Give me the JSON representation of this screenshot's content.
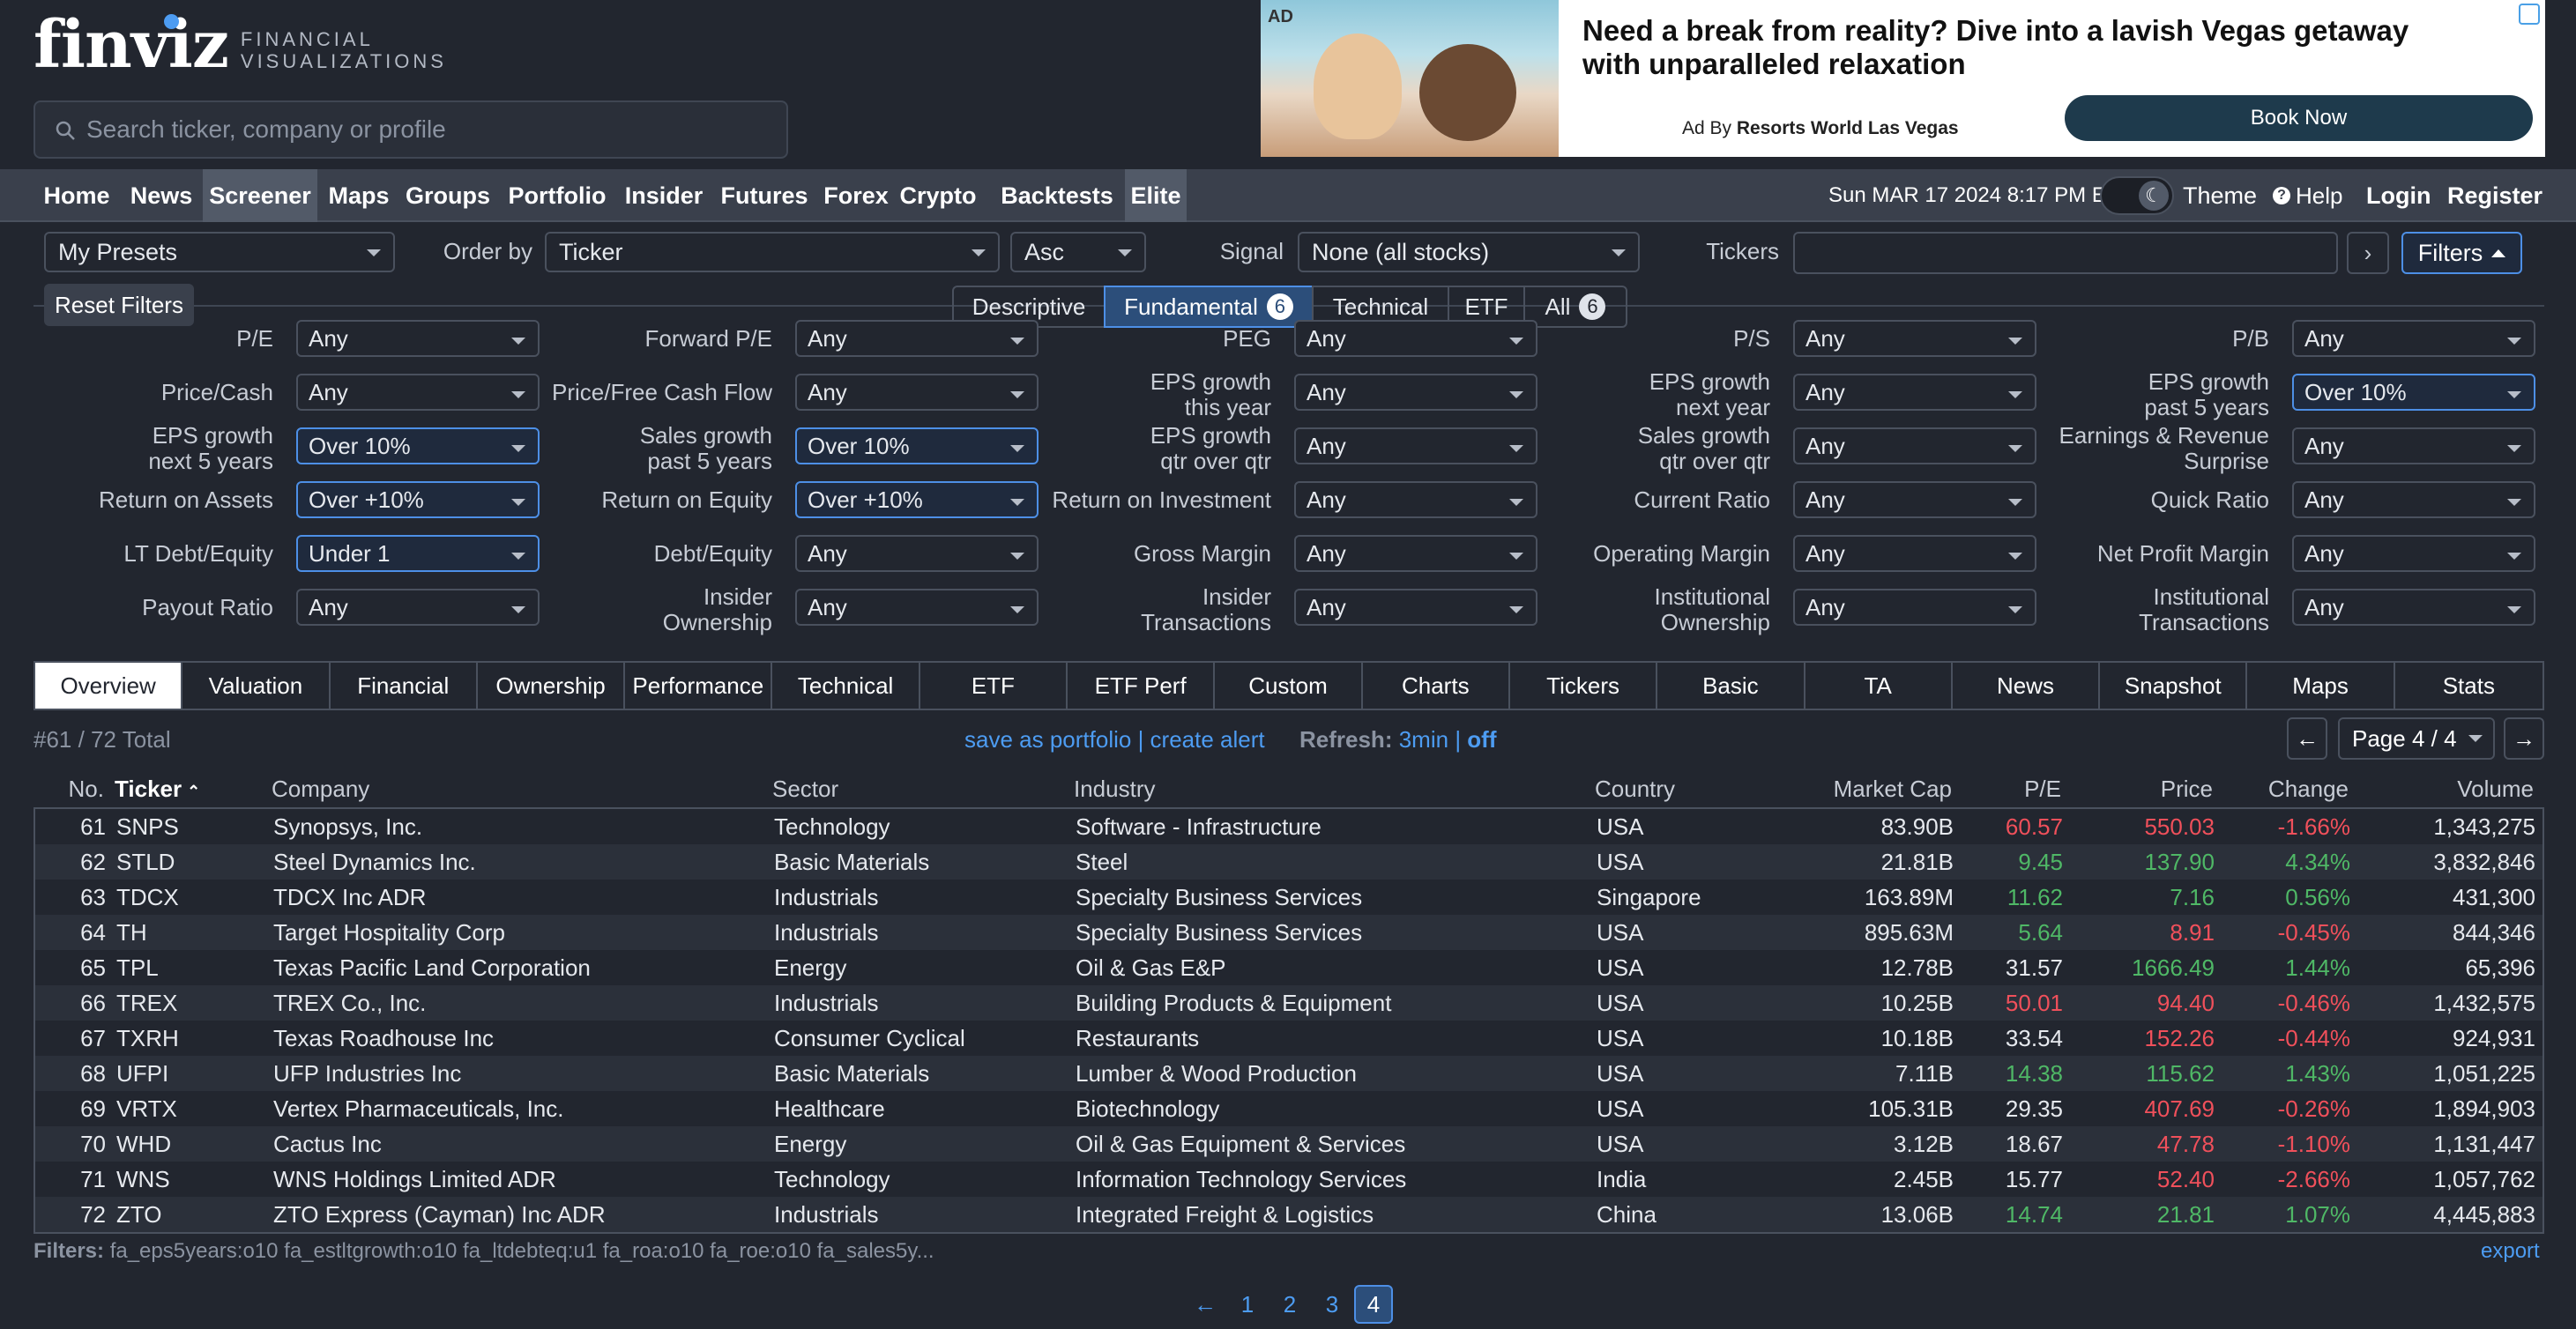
{
  "logo": {
    "word": "finviz",
    "sub1": "FINANCIAL",
    "sub2": "VISUALIZATIONS"
  },
  "search": {
    "placeholder": "Search ticker, company or profile"
  },
  "ad": {
    "tag": "AD",
    "headline": "Need a break from reality? Dive into a lavish Vegas getaway with unparalleled relaxation",
    "by_prefix": "Ad By ",
    "by_name": "Resorts World Las Vegas",
    "button": "Book Now"
  },
  "nav": {
    "items": [
      "Home",
      "News",
      "Screener",
      "Maps",
      "Groups",
      "Portfolio",
      "Insider",
      "Futures",
      "Forex",
      "Crypto",
      "Backtests",
      "Elite"
    ],
    "active": "Screener",
    "datetime": "Sun MAR 17 2024 8:17 PM ET",
    "theme": "Theme",
    "help": "Help",
    "login": "Login",
    "register": "Register"
  },
  "controls": {
    "presets": "My Presets",
    "order_by_label": "Order by",
    "order_by": "Ticker",
    "order_dir": "Asc",
    "signal_label": "Signal",
    "signal": "None (all stocks)",
    "tickers_label": "Tickers",
    "filters_button": "Filters"
  },
  "filter_tabs": {
    "reset": "Reset Filters",
    "tabs": [
      {
        "label": "Descriptive",
        "badge": ""
      },
      {
        "label": "Fundamental",
        "badge": "6"
      },
      {
        "label": "Technical",
        "badge": ""
      },
      {
        "label": "ETF",
        "badge": ""
      },
      {
        "label": "All",
        "badge": "6"
      }
    ],
    "active": "Fundamental"
  },
  "filters": [
    [
      {
        "l1": "P/E",
        "l2": "",
        "v": "Any"
      },
      {
        "l1": "Forward P/E",
        "l2": "",
        "v": "Any"
      },
      {
        "l1": "PEG",
        "l2": "",
        "v": "Any"
      },
      {
        "l1": "P/S",
        "l2": "",
        "v": "Any"
      },
      {
        "l1": "P/B",
        "l2": "",
        "v": "Any"
      }
    ],
    [
      {
        "l1": "Price/Cash",
        "l2": "",
        "v": "Any"
      },
      {
        "l1": "Price/Free Cash Flow",
        "l2": "",
        "v": "Any"
      },
      {
        "l1": "EPS growth",
        "l2": "this year",
        "v": "Any"
      },
      {
        "l1": "EPS growth",
        "l2": "next year",
        "v": "Any"
      },
      {
        "l1": "EPS growth",
        "l2": "past 5 years",
        "v": "Over 10%"
      }
    ],
    [
      {
        "l1": "EPS growth",
        "l2": "next 5 years",
        "v": "Over 10%"
      },
      {
        "l1": "Sales growth",
        "l2": "past 5 years",
        "v": "Over 10%"
      },
      {
        "l1": "EPS growth",
        "l2": "qtr over qtr",
        "v": "Any"
      },
      {
        "l1": "Sales growth",
        "l2": "qtr over qtr",
        "v": "Any"
      },
      {
        "l1": "Earnings & Revenue",
        "l2": "Surprise",
        "v": "Any"
      }
    ],
    [
      {
        "l1": "Return on Assets",
        "l2": "",
        "v": "Over +10%"
      },
      {
        "l1": "Return on Equity",
        "l2": "",
        "v": "Over +10%"
      },
      {
        "l1": "Return on Investment",
        "l2": "",
        "v": "Any"
      },
      {
        "l1": "Current Ratio",
        "l2": "",
        "v": "Any"
      },
      {
        "l1": "Quick Ratio",
        "l2": "",
        "v": "Any"
      }
    ],
    [
      {
        "l1": "LT Debt/Equity",
        "l2": "",
        "v": "Under 1"
      },
      {
        "l1": "Debt/Equity",
        "l2": "",
        "v": "Any"
      },
      {
        "l1": "Gross Margin",
        "l2": "",
        "v": "Any"
      },
      {
        "l1": "Operating Margin",
        "l2": "",
        "v": "Any"
      },
      {
        "l1": "Net Profit Margin",
        "l2": "",
        "v": "Any"
      }
    ],
    [
      {
        "l1": "Payout Ratio",
        "l2": "",
        "v": "Any"
      },
      {
        "l1": "Insider",
        "l2": "Ownership",
        "v": "Any"
      },
      {
        "l1": "Insider",
        "l2": "Transactions",
        "v": "Any"
      },
      {
        "l1": "Institutional",
        "l2": "Ownership",
        "v": "Any"
      },
      {
        "l1": "Institutional",
        "l2": "Transactions",
        "v": "Any"
      }
    ]
  ],
  "view_tabs": {
    "items": [
      "Overview",
      "Valuation",
      "Financial",
      "Ownership",
      "Performance",
      "Technical",
      "ETF",
      "ETF Perf",
      "Custom",
      "Charts",
      "Tickers",
      "Basic",
      "TA",
      "News",
      "Snapshot",
      "Maps",
      "Stats"
    ],
    "active": "Overview"
  },
  "results": {
    "total": "#61 / 72 Total",
    "save_portfolio": "save as portfolio",
    "create_alert": "create alert",
    "refresh_label": "Refresh:",
    "refresh_value": "3min",
    "refresh_off": "off",
    "page_select": "Page 4 / 4"
  },
  "table": {
    "headers": [
      "No.",
      "Ticker",
      "Company",
      "Sector",
      "Industry",
      "Country",
      "Market Cap",
      "P/E",
      "Price",
      "Change",
      "Volume"
    ],
    "rows": [
      {
        "no": "61",
        "ticker": "SNPS",
        "company": "Synopsys, Inc.",
        "sector": "Technology",
        "industry": "Software - Infrastructure",
        "country": "USA",
        "mcap": "83.90B",
        "pe": "60.57",
        "price": "550.03",
        "change": "-1.66%",
        "volume": "1,343,275",
        "pe_c": "neg",
        "price_c": "neg",
        "chg_c": "neg"
      },
      {
        "no": "62",
        "ticker": "STLD",
        "company": "Steel Dynamics Inc.",
        "sector": "Basic Materials",
        "industry": "Steel",
        "country": "USA",
        "mcap": "21.81B",
        "pe": "9.45",
        "price": "137.90",
        "change": "4.34%",
        "volume": "3,832,846",
        "pe_c": "pos",
        "price_c": "pos",
        "chg_c": "pos"
      },
      {
        "no": "63",
        "ticker": "TDCX",
        "company": "TDCX Inc ADR",
        "sector": "Industrials",
        "industry": "Specialty Business Services",
        "country": "Singapore",
        "mcap": "163.89M",
        "pe": "11.62",
        "price": "7.16",
        "change": "0.56%",
        "volume": "431,300",
        "pe_c": "pos",
        "price_c": "pos",
        "chg_c": "pos"
      },
      {
        "no": "64",
        "ticker": "TH",
        "company": "Target Hospitality Corp",
        "sector": "Industrials",
        "industry": "Specialty Business Services",
        "country": "USA",
        "mcap": "895.63M",
        "pe": "5.64",
        "price": "8.91",
        "change": "-0.45%",
        "volume": "844,346",
        "pe_c": "pos",
        "price_c": "neg",
        "chg_c": "neg"
      },
      {
        "no": "65",
        "ticker": "TPL",
        "company": "Texas Pacific Land Corporation",
        "sector": "Energy",
        "industry": "Oil & Gas E&P",
        "country": "USA",
        "mcap": "12.78B",
        "pe": "31.57",
        "price": "1666.49",
        "change": "1.44%",
        "volume": "65,396",
        "pe_c": "neu",
        "price_c": "pos",
        "chg_c": "pos"
      },
      {
        "no": "66",
        "ticker": "TREX",
        "company": "TREX Co., Inc.",
        "sector": "Industrials",
        "industry": "Building Products & Equipment",
        "country": "USA",
        "mcap": "10.25B",
        "pe": "50.01",
        "price": "94.40",
        "change": "-0.46%",
        "volume": "1,432,575",
        "pe_c": "neg",
        "price_c": "neg",
        "chg_c": "neg"
      },
      {
        "no": "67",
        "ticker": "TXRH",
        "company": "Texas Roadhouse Inc",
        "sector": "Consumer Cyclical",
        "industry": "Restaurants",
        "country": "USA",
        "mcap": "10.18B",
        "pe": "33.54",
        "price": "152.26",
        "change": "-0.44%",
        "volume": "924,931",
        "pe_c": "neu",
        "price_c": "neg",
        "chg_c": "neg"
      },
      {
        "no": "68",
        "ticker": "UFPI",
        "company": "UFP Industries Inc",
        "sector": "Basic Materials",
        "industry": "Lumber & Wood Production",
        "country": "USA",
        "mcap": "7.11B",
        "pe": "14.38",
        "price": "115.62",
        "change": "1.43%",
        "volume": "1,051,225",
        "pe_c": "pos",
        "price_c": "pos",
        "chg_c": "pos"
      },
      {
        "no": "69",
        "ticker": "VRTX",
        "company": "Vertex Pharmaceuticals, Inc.",
        "sector": "Healthcare",
        "industry": "Biotechnology",
        "country": "USA",
        "mcap": "105.31B",
        "pe": "29.35",
        "price": "407.69",
        "change": "-0.26%",
        "volume": "1,894,903",
        "pe_c": "neu",
        "price_c": "neg",
        "chg_c": "neg"
      },
      {
        "no": "70",
        "ticker": "WHD",
        "company": "Cactus Inc",
        "sector": "Energy",
        "industry": "Oil & Gas Equipment & Services",
        "country": "USA",
        "mcap": "3.12B",
        "pe": "18.67",
        "price": "47.78",
        "change": "-1.10%",
        "volume": "1,131,447",
        "pe_c": "neu",
        "price_c": "neg",
        "chg_c": "neg"
      },
      {
        "no": "71",
        "ticker": "WNS",
        "company": "WNS Holdings Limited ADR",
        "sector": "Technology",
        "industry": "Information Technology Services",
        "country": "India",
        "mcap": "2.45B",
        "pe": "15.77",
        "price": "52.40",
        "change": "-2.66%",
        "volume": "1,057,762",
        "pe_c": "neu",
        "price_c": "neg",
        "chg_c": "neg"
      },
      {
        "no": "72",
        "ticker": "ZTO",
        "company": "ZTO Express (Cayman) Inc ADR",
        "sector": "Industrials",
        "industry": "Integrated Freight & Logistics",
        "country": "China",
        "mcap": "13.06B",
        "pe": "14.74",
        "price": "21.81",
        "change": "1.07%",
        "volume": "4,445,883",
        "pe_c": "pos",
        "price_c": "pos",
        "chg_c": "pos"
      }
    ]
  },
  "footer": {
    "filters_label": "Filters:",
    "filters_text": "fa_eps5years:o10 fa_estltgrowth:o10 fa_ltdebteq:u1 fa_roa:o10 fa_roe:o10 fa_sales5y...",
    "export": "export",
    "pages": [
      "1",
      "2",
      "3",
      "4"
    ],
    "active_page": "4"
  },
  "colors": {
    "positive": "#4fb866",
    "negative": "#f0505b",
    "link": "#4d9cf2",
    "accent": "#4d8fe6"
  }
}
